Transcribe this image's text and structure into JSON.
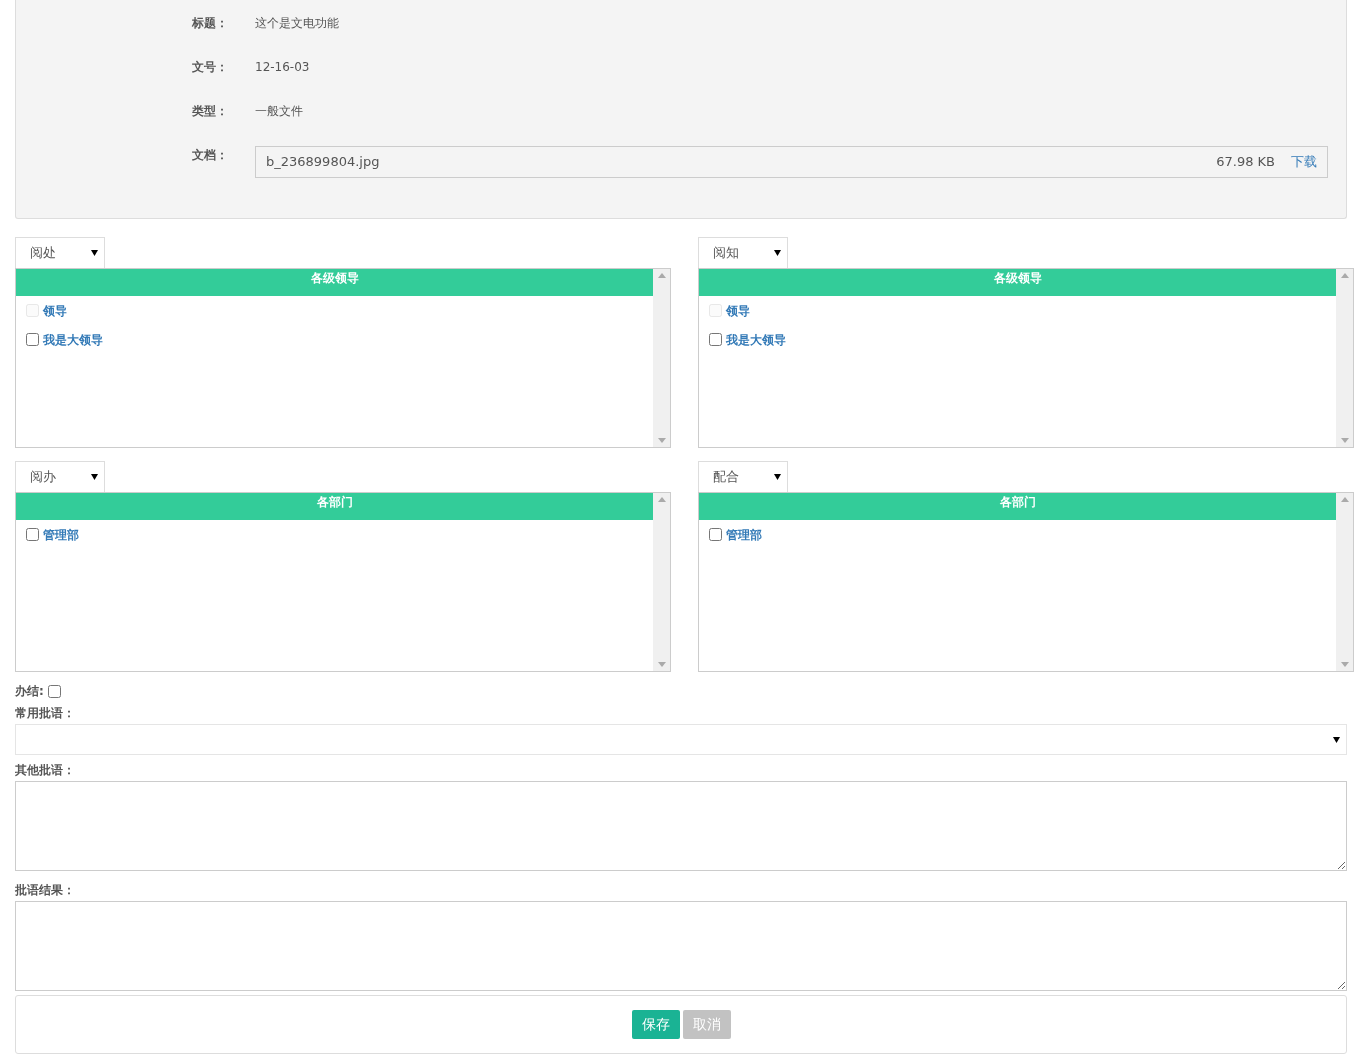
{
  "info": [
    {
      "label": "标题：",
      "value": "这个是文电功能"
    },
    {
      "label": "文号：",
      "value": "12-16-03"
    },
    {
      "label": "类型：",
      "value": "一般文件"
    }
  ],
  "document": {
    "label": "文档：",
    "file_name": "b_236899804.jpg",
    "size": "67.98 KB",
    "link": "下载"
  },
  "panels": [
    {
      "select": "阅处",
      "header": "各级领导",
      "items": [
        {
          "label": "领导",
          "checked": false,
          "disabled": true
        },
        {
          "label": "我是大领导",
          "checked": false,
          "disabled": false
        }
      ]
    },
    {
      "select": "阅知",
      "header": "各级领导",
      "items": [
        {
          "label": "领导",
          "checked": false,
          "disabled": true
        },
        {
          "label": "我是大领导",
          "checked": false,
          "disabled": false
        }
      ]
    },
    {
      "select": "阅办",
      "header": "各部门",
      "items": [
        {
          "label": "管理部",
          "checked": false,
          "disabled": false
        }
      ]
    },
    {
      "select": "配合",
      "header": "各部门",
      "items": [
        {
          "label": "管理部",
          "checked": false,
          "disabled": false
        }
      ]
    }
  ],
  "finish": {
    "label": "办结:",
    "checked": false
  },
  "common_comment": {
    "label": "常用批语："
  },
  "other_comment": {
    "label": "其他批语："
  },
  "result": {
    "label": "批语结果："
  },
  "buttons": [
    {
      "label": "保存",
      "kind": "primary"
    },
    {
      "label": "取消",
      "kind": "secondary"
    }
  ]
}
